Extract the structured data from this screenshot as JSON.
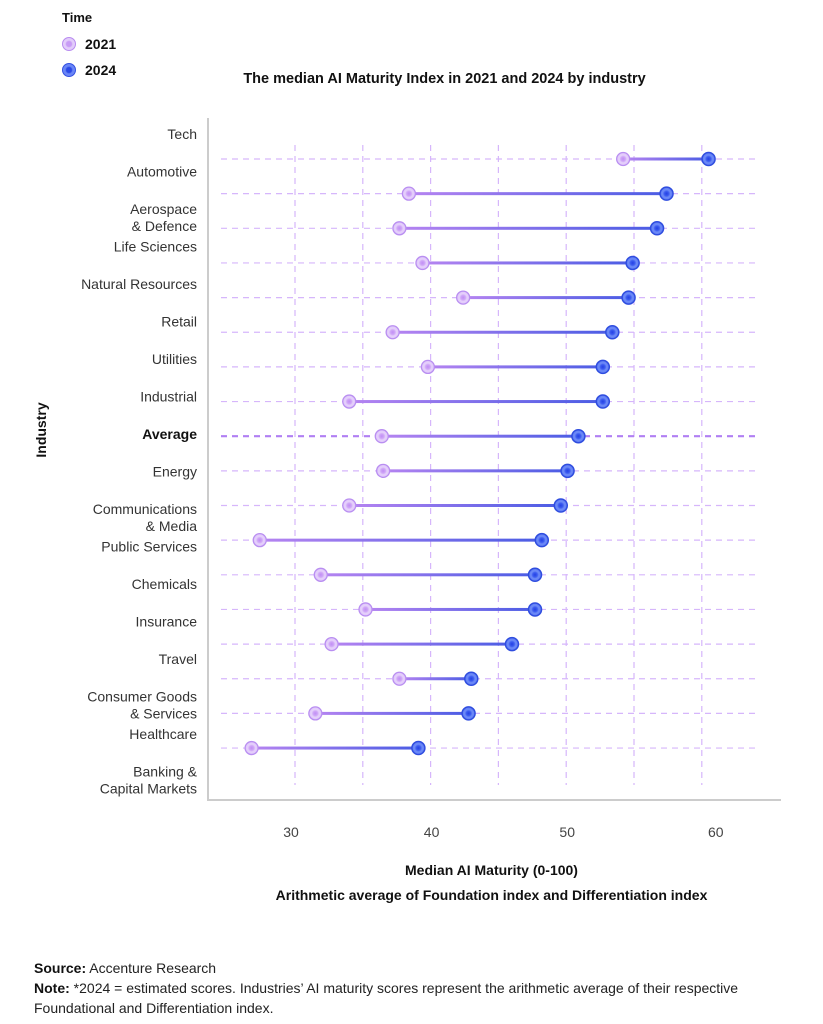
{
  "legend": {
    "title": "Time",
    "items": [
      {
        "label": "2021",
        "color": "#c89bf6"
      },
      {
        "label": "2024",
        "color": "#3f5cec"
      }
    ]
  },
  "footer": {
    "source_label": "Source:",
    "source_text": "Accenture Research",
    "note_label": "Note:",
    "note_text": "*2024 = estimated scores. Industries’ AI maturity scores represent the arithmetic average of their respective Foundational and Differentiation index."
  },
  "chart_data": {
    "type": "dumbbell",
    "title": "The median AI Maturity Index in 2021 and 2024 by industry",
    "xlabel": "Median AI Maturity (0-100)",
    "xlabel_sub": "Arithmetic average of  Foundation index and Differentiation index",
    "ylabel": "Industry",
    "xlim": [
      25,
      63
    ],
    "xticks": [
      30,
      40,
      50,
      60
    ],
    "grid": true,
    "legend_position": "top-left",
    "highlight_category": "Average",
    "categories": [
      [
        "Tech"
      ],
      [
        "Automotive"
      ],
      [
        "Aerospace",
        "& Defence"
      ],
      [
        "Life Sciences"
      ],
      [
        "Natural Resources"
      ],
      [
        "Retail"
      ],
      [
        "Utilities"
      ],
      [
        "Industrial"
      ],
      [
        "Average"
      ],
      [
        "Energy"
      ],
      [
        "Communications",
        "& Media"
      ],
      [
        "Public Services"
      ],
      [
        "Chemicals"
      ],
      [
        "Insurance"
      ],
      [
        "Travel"
      ],
      [
        "Consumer Goods",
        "& Services"
      ],
      [
        "Healthcare"
      ],
      [
        "Banking &",
        "Capital Markets"
      ]
    ],
    "series": [
      {
        "name": "2021",
        "values": [
          54.2,
          38.4,
          37.7,
          39.4,
          42.4,
          37.2,
          39.8,
          34.0,
          36.4,
          36.5,
          34.0,
          27.4,
          31.9,
          35.2,
          32.7,
          37.7,
          31.5,
          26.8
        ]
      },
      {
        "name": "2024",
        "values": [
          60.5,
          57.4,
          56.7,
          54.9,
          54.6,
          53.4,
          52.7,
          52.7,
          50.9,
          50.1,
          49.6,
          48.2,
          47.7,
          47.7,
          46.0,
          43.0,
          42.8,
          39.1
        ]
      }
    ]
  }
}
